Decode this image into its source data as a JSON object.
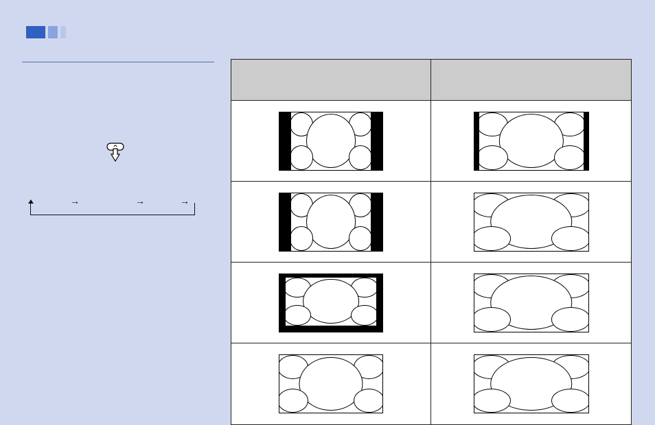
{
  "table": {
    "headers": [
      "",
      ""
    ],
    "rows": [
      {
        "left": {
          "style": "pillarbox",
          "circles": true
        },
        "right": {
          "style": "pillarbox-thin",
          "circles": true
        }
      },
      {
        "left": {
          "style": "pillarbox",
          "circles": true
        },
        "right": {
          "style": "plain-wide stretch",
          "circles": true
        }
      },
      {
        "left": {
          "style": "frame-thick",
          "circles": true
        },
        "right": {
          "style": "plain-wide stretch",
          "circles": true
        }
      },
      {
        "left": {
          "style": "plain",
          "circles": true
        },
        "right": {
          "style": "plain-wide stretch",
          "circles": true
        }
      }
    ]
  },
  "flow": {
    "arrows": [
      "→",
      "→",
      "→"
    ]
  }
}
